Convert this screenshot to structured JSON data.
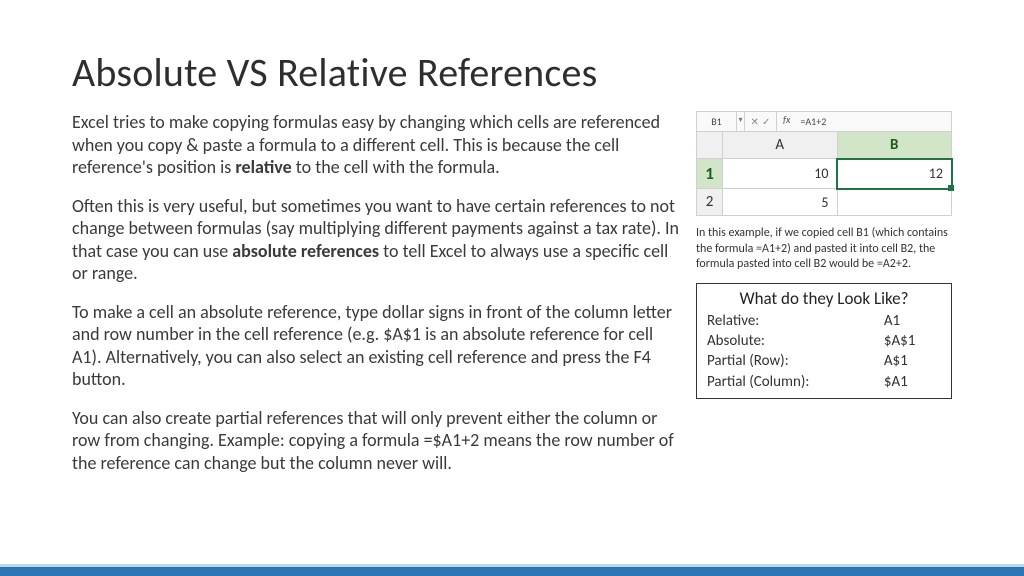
{
  "title": "Absolute VS Relative References",
  "para1_pre": "Excel tries to make copying formulas easy by changing which cells are referenced when you copy & paste a formula to a different cell. This is because the cell reference's position is ",
  "para1_bold": "relative",
  "para1_post": " to the cell with the formula.",
  "para2_pre": "Often this is very useful, but sometimes you want to have certain references to not change between formulas (say multiplying different payments against a tax rate). In that case you can use ",
  "para2_bold": "absolute references",
  "para2_post": " to tell Excel to always use a specific cell or range.",
  "para3": "To make a cell an absolute reference, type dollar signs in front of the column letter and row number in the cell reference (e.g. $A$1 is an absolute reference for cell A1). Alternatively, you can also select an existing cell reference and press the F4 button.",
  "para4": "You can also create partial references that will only prevent either the column or row from changing. Example: copying a formula =$A1+2 means the row number of the reference can change but the column never will.",
  "excel": {
    "namebox": "B1",
    "fx_label": "fx",
    "formula": "=A1+2",
    "cols": [
      "A",
      "B"
    ],
    "rows": [
      {
        "num": "1",
        "cells": [
          "10",
          "12"
        ]
      },
      {
        "num": "2",
        "cells": [
          "5",
          ""
        ]
      }
    ]
  },
  "caption": "In this example, if we copied cell B1 (which contains the formula =A1+2) and pasted it into cell B2, the formula pasted into cell B2 would be =A2+2.",
  "lookbox": {
    "title": "What do they Look Like?",
    "rows": [
      {
        "label": "Relative:",
        "value": "A1"
      },
      {
        "label": "Absolute:",
        "value": "$A$1"
      },
      {
        "label": "Partial (Row):",
        "value": "A$1"
      },
      {
        "label": "Partial (Column):",
        "value": "$A1"
      }
    ]
  }
}
